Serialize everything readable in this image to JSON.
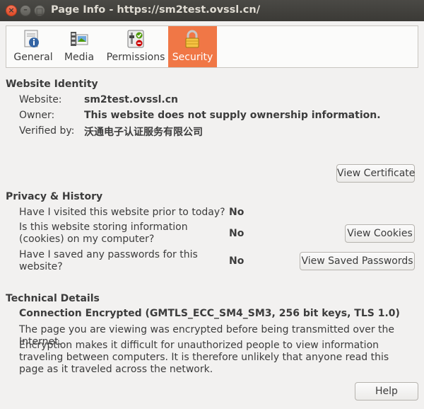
{
  "window": {
    "title": "Page Info - https://sm2test.ovssl.cn/",
    "close_glyph": "×",
    "min_glyph": "–",
    "max_glyph": "□"
  },
  "tabs": [
    {
      "label": "General",
      "icon": "info-page-icon",
      "active": false
    },
    {
      "label": "Media",
      "icon": "media-film-icon",
      "active": false
    },
    {
      "label": "Permissions",
      "icon": "permissions-toggle-icon",
      "active": false
    },
    {
      "label": "Security",
      "icon": "padlock-icon",
      "active": true
    }
  ],
  "identity": {
    "title": "Website Identity",
    "website_label": "Website:",
    "website_value": "sm2test.ovssl.cn",
    "owner_label": "Owner:",
    "owner_value": "This website does not supply ownership information.",
    "verified_label": "Verified by:",
    "verified_value": "沃通电子认证服务有限公司",
    "view_certificate": "View Certificate"
  },
  "privacy": {
    "title": "Privacy & History",
    "q1": "Have I visited this website prior to today?",
    "a1": "No",
    "q2": "Is this website storing information (cookies) on my computer?",
    "a2": "No",
    "view_cookies": "View Cookies",
    "q3": "Have I saved any passwords for this website?",
    "a3": "No",
    "view_passwords": "View Saved Passwords"
  },
  "technical": {
    "title": "Technical Details",
    "connection": "Connection Encrypted (GMTLS_ECC_SM4_SM3, 256 bit keys, TLS 1.0)",
    "para1": "The page you are viewing was encrypted before being transmitted over the Internet.",
    "para2": "Encryption makes it difficult for unauthorized people to view information traveling between computers. It is therefore unlikely that anyone read this page as it traveled across the network."
  },
  "help_label": "Help",
  "colors": {
    "active_tab": "#f07746",
    "titlebar": "#3b3a36",
    "background": "#f2f1f0"
  }
}
